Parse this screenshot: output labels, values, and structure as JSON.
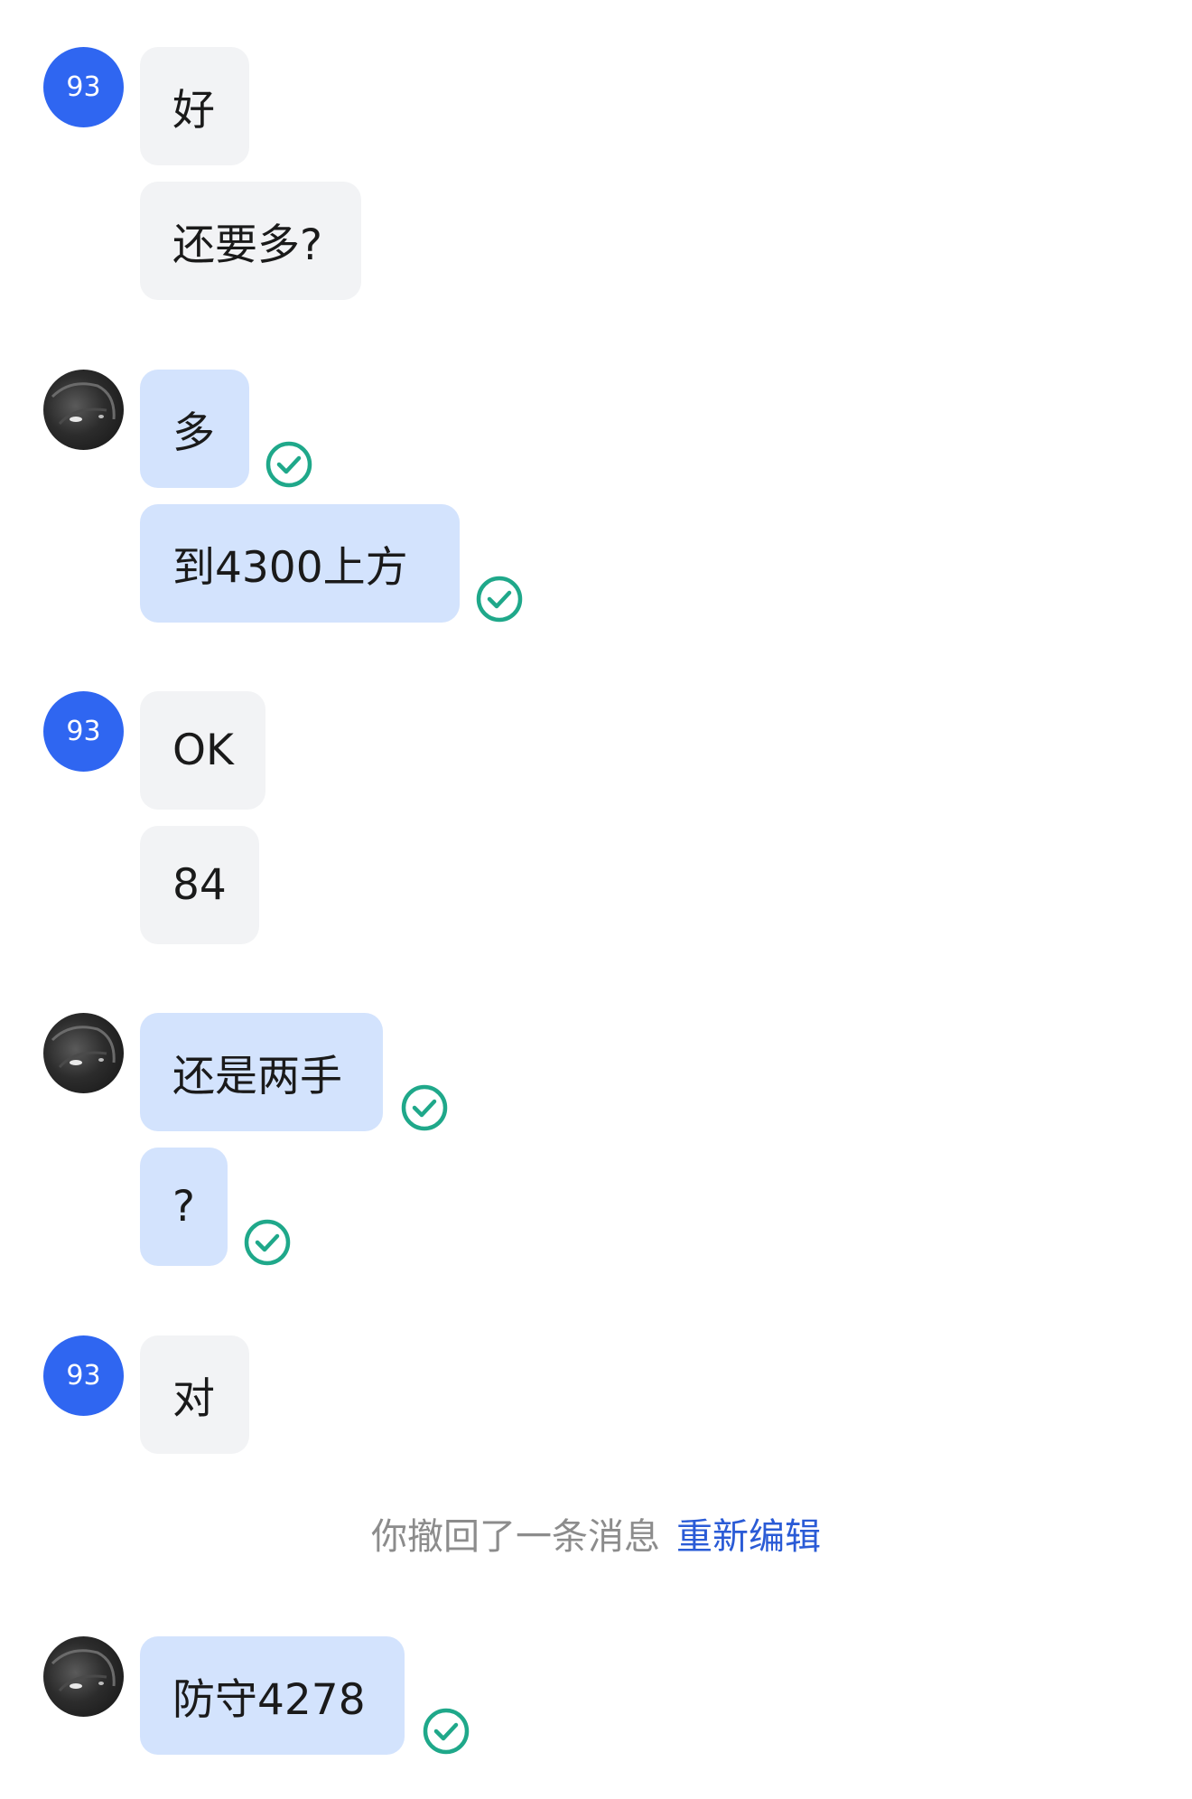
{
  "contacts": {
    "other_initials": "93"
  },
  "messages": [
    {
      "from": "other",
      "text": "好",
      "read": false
    },
    {
      "from": "other",
      "text": "还要多?",
      "read": false
    },
    {
      "from": "self",
      "text": "多",
      "read": true
    },
    {
      "from": "self",
      "text": "到4300上方",
      "read": true
    },
    {
      "from": "other",
      "text": "OK",
      "read": false
    },
    {
      "from": "other",
      "text": "84",
      "read": false
    },
    {
      "from": "self",
      "text": "还是两手",
      "read": true
    },
    {
      "from": "self",
      "text": "?",
      "read": true
    },
    {
      "from": "other",
      "text": "对",
      "read": false
    },
    {
      "from": "self",
      "text": "防守4278",
      "read": true
    }
  ],
  "system_notice": {
    "text": "你撤回了一条消息",
    "action": "重新编辑"
  },
  "colors": {
    "other_avatar": "#2f66f1",
    "incoming_bubble": "#f2f3f5",
    "outgoing_bubble": "#d3e3fd",
    "read_check": "#1fa88a",
    "link": "#2a5bd6"
  },
  "icons": {
    "read_receipt": "check-circle-icon"
  }
}
